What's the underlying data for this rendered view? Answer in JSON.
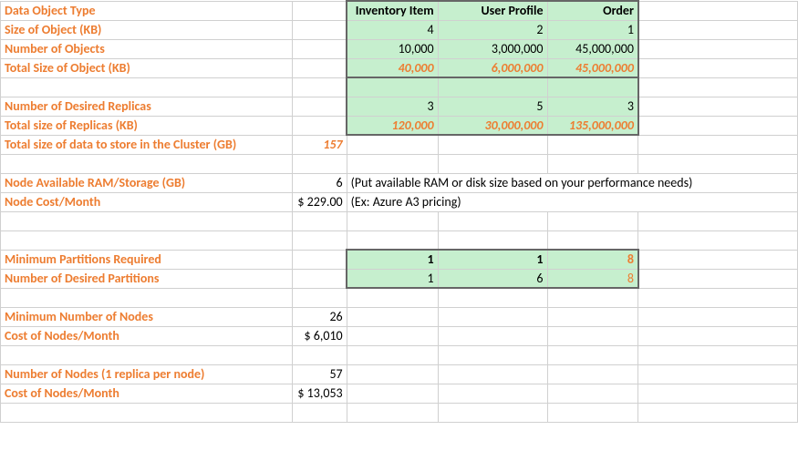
{
  "labels": {
    "data_object_type": "Data Object Type",
    "size_of_object": "Size of Object (KB)",
    "number_of_objects": "Number of Objects",
    "total_size_of_object": "Total Size of Object (KB)",
    "number_of_desired_replicas": "Number of Desired Replicas",
    "total_size_of_replicas": "Total size of Replicas (KB)",
    "total_size_cluster": "Total size of data to store in the Cluster (GB)",
    "node_available_ram": "Node Available RAM/Storage (GB)",
    "node_cost_month": "Node Cost/Month",
    "min_partitions_required": "Minimum Partitions Required",
    "num_desired_partitions": "Number of Desired Partitions",
    "min_number_of_nodes": "Minimum Number of Nodes",
    "cost_of_nodes_month": "Cost of Nodes/Month",
    "num_nodes_one_replica": "Number of Nodes (1 replica per node)",
    "cost_of_nodes_month2": "Cost of Nodes/Month"
  },
  "headers": {
    "col1": "Inventory Item",
    "col2": "User Profile",
    "col3": "Order"
  },
  "size_of_object": {
    "c1": "4",
    "c2": "2",
    "c3": "1"
  },
  "number_of_objects": {
    "c1": "10,000",
    "c2": "3,000,000",
    "c3": "45,000,000"
  },
  "total_size_of_object": {
    "c1": "40,000",
    "c2": "6,000,000",
    "c3": "45,000,000"
  },
  "number_of_desired_replicas": {
    "c1": "3",
    "c2": "5",
    "c3": "3"
  },
  "total_size_of_replicas": {
    "c1": "120,000",
    "c2": "30,000,000",
    "c3": "135,000,000"
  },
  "total_size_cluster_gb": "157",
  "node_available_ram_gb": "6",
  "node_cost_month": "$ 229.00",
  "note_ram": "(Put available RAM or disk size based on your performance needs)",
  "note_cost": "(Ex: Azure A3 pricing)",
  "min_partitions": {
    "c1": "1",
    "c2": "1",
    "c3": "8"
  },
  "desired_partitions": {
    "c1": "1",
    "c2": "6",
    "c3": "8"
  },
  "min_nodes": "26",
  "cost_min_nodes": "$  6,010",
  "nodes_one_replica": "57",
  "cost_nodes_one_replica": "$ 13,053",
  "chart_data": {
    "type": "table",
    "title": "Cluster sizing worksheet",
    "columns": [
      "Inventory Item",
      "User Profile",
      "Order"
    ],
    "rows": [
      {
        "metric": "Size of Object (KB)",
        "values": [
          4,
          2,
          1
        ]
      },
      {
        "metric": "Number of Objects",
        "values": [
          10000,
          3000000,
          45000000
        ]
      },
      {
        "metric": "Total Size of Object (KB)",
        "values": [
          40000,
          6000000,
          45000000
        ]
      },
      {
        "metric": "Number of Desired Replicas",
        "values": [
          3,
          5,
          3
        ]
      },
      {
        "metric": "Total size of Replicas (KB)",
        "values": [
          120000,
          30000000,
          135000000
        ]
      },
      {
        "metric": "Minimum Partitions Required",
        "values": [
          1,
          1,
          8
        ]
      },
      {
        "metric": "Number of Desired Partitions",
        "values": [
          1,
          6,
          8
        ]
      }
    ],
    "scalars": {
      "Total size of data to store in the Cluster (GB)": 157,
      "Node Available RAM/Storage (GB)": 6,
      "Node Cost/Month": 229.0,
      "Minimum Number of Nodes": 26,
      "Cost of Nodes/Month (min)": 6010,
      "Number of Nodes (1 replica per node)": 57,
      "Cost of Nodes/Month (1 replica)": 13053
    }
  }
}
